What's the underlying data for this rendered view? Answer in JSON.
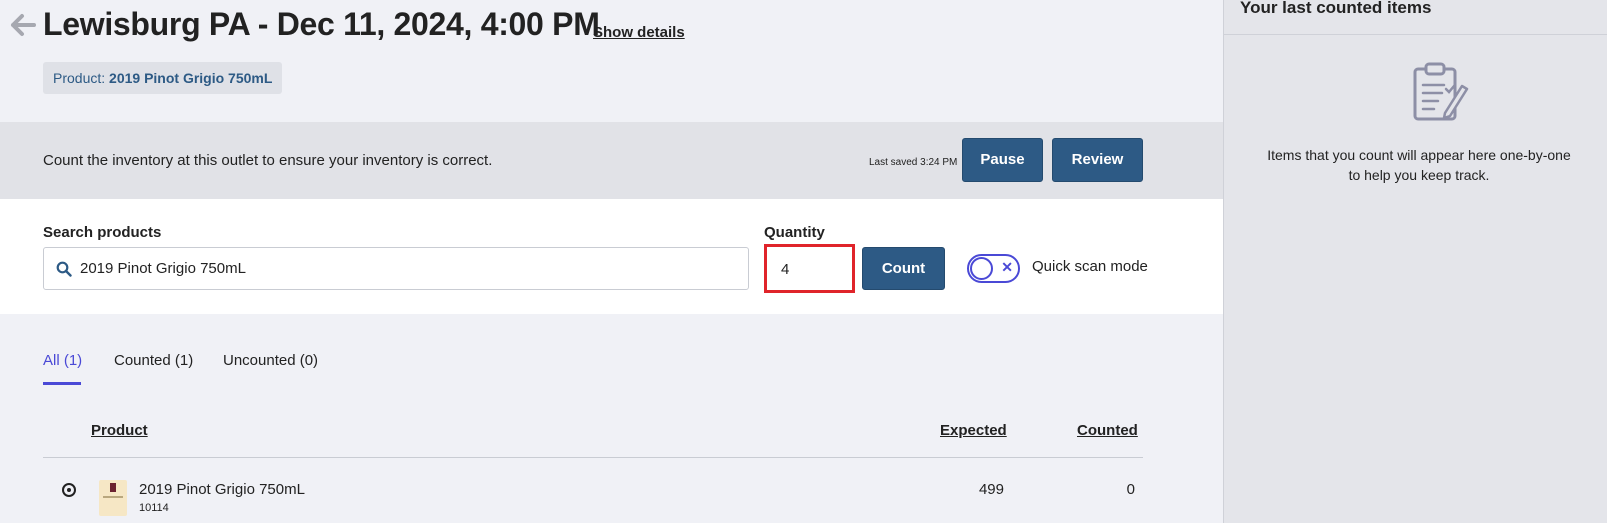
{
  "header": {
    "title": "Lewisburg PA - Dec 11, 2024, 4:00 PM",
    "show_details": "Show details",
    "product_chip_label": "Product:",
    "product_chip_value": "2019 Pinot Grigio 750mL"
  },
  "info_bar": {
    "text": "Count the inventory at this outlet to ensure your inventory is correct.",
    "last_saved": "Last saved 3:24 PM",
    "pause_label": "Pause",
    "review_label": "Review"
  },
  "search": {
    "search_label": "Search products",
    "search_value": "2019 Pinot Grigio 750mL",
    "quantity_label": "Quantity",
    "quantity_value": "4",
    "count_label": "Count",
    "quick_scan_label": "Quick scan mode",
    "quick_scan_on": false
  },
  "tabs": [
    {
      "label": "All (1)",
      "active": true
    },
    {
      "label": "Counted (1)",
      "active": false
    },
    {
      "label": "Uncounted (0)",
      "active": false
    }
  ],
  "table": {
    "headers": {
      "product": "Product",
      "expected": "Expected",
      "counted": "Counted"
    },
    "rows": [
      {
        "name": "2019 Pinot Grigio 750mL",
        "sku": "10114",
        "expected": "499",
        "counted": "0"
      }
    ]
  },
  "sidebar": {
    "title": "Your last counted items",
    "empty_text": "Items that you count will appear here one-by-one to help you keep track."
  },
  "colors": {
    "primary": "#2d5a85",
    "accent": "#4a49d6",
    "highlight": "#e0242a"
  },
  "icons": [
    "back-arrow-icon",
    "search-icon",
    "close-icon",
    "clipboard-icon",
    "radio-icon"
  ]
}
